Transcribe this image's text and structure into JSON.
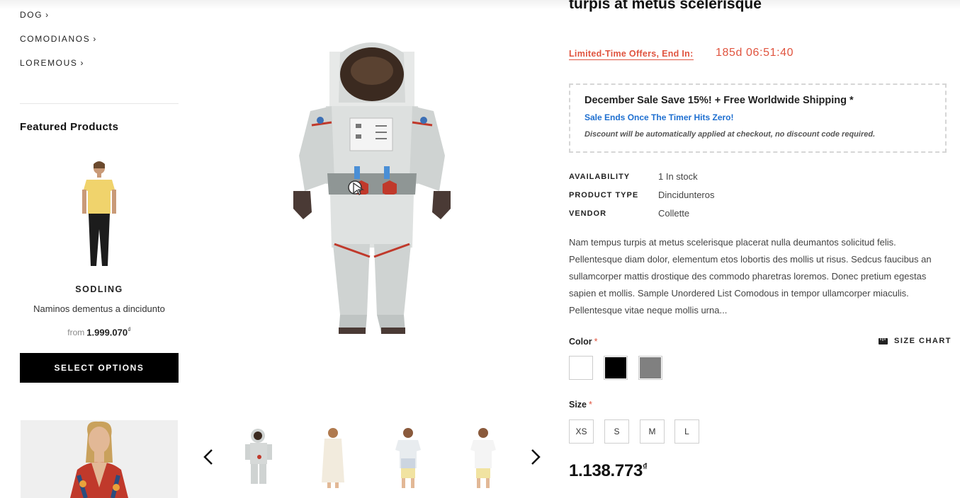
{
  "sidebar": {
    "categories": [
      {
        "label": "DOG"
      },
      {
        "label": "COMODIANOS"
      },
      {
        "label": "LOREMOUS"
      }
    ],
    "featured_title": "Featured Products",
    "featured_product": {
      "name": "SODLING",
      "description": "Naminos dementus a dincidunto",
      "price_prefix": "from",
      "price": "1.999.070",
      "currency": "₫"
    },
    "select_button": "SELECT OPTIONS"
  },
  "product": {
    "title": "turpis at metus scelerisque",
    "offer_label": "Limited-Time Offers, End In:",
    "offer_timer": "185d 06:51:40",
    "sale": {
      "headline": "December Sale Save 15%! + Free Worldwide Shipping *",
      "subline": "Sale Ends Once The Timer Hits Zero!",
      "note": "Discount will be automatically applied at checkout, no discount code required."
    },
    "meta": [
      {
        "key": "AVAILABILITY",
        "value": "1 In stock"
      },
      {
        "key": "PRODUCT TYPE",
        "value": "Dincidunteros"
      },
      {
        "key": "VENDOR",
        "value": "Collette"
      }
    ],
    "description": "Nam tempus turpis at metus scelerisque placerat nulla deumantos solicitud felis. Pellentesque diam dolor, elementum etos lobortis des mollis ut risus. Sedcus faucibus an sullamcorper mattis drostique des commodo pharetras loremos. Donec pretium egestas sapien et mollis. Sample Unordered List Comodous in tempor ullamcorper miaculis. Pellentesque vitae neque mollis urna...",
    "color_label": "Color",
    "required_mark": "*",
    "size_chart": "SIZE CHART",
    "colors": [
      "#ffffff",
      "#000000",
      "#808080"
    ],
    "size_label": "Size",
    "sizes": [
      "XS",
      "S",
      "M",
      "L"
    ],
    "price": "1.138.773",
    "currency": "₫"
  },
  "thumbnails": [
    "astronaut",
    "dress-back",
    "tshirt-front",
    "tshirt-back"
  ]
}
